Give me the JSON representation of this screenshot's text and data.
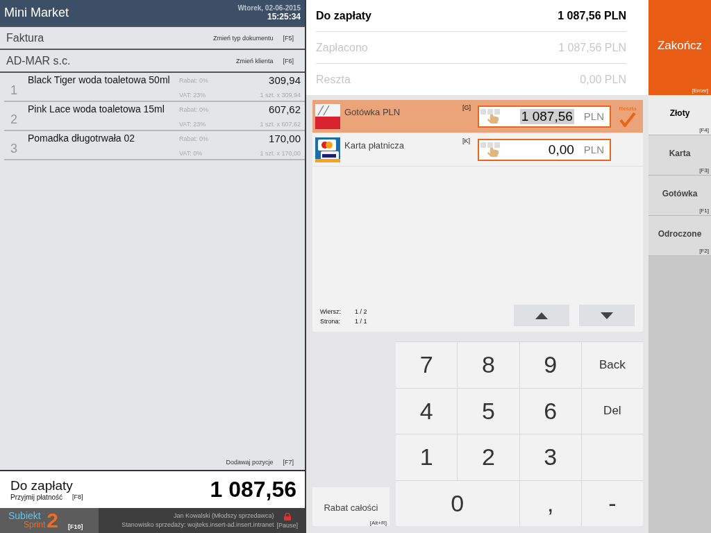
{
  "header": {
    "title": "Mini Market",
    "date": "Wtorek, 02-06-2015",
    "time": "15:25:34"
  },
  "document": {
    "type": "Faktura",
    "action": "Zmień typ dokumentu",
    "shortcut": "[F5]"
  },
  "client": {
    "name": "AD-MAR s.c.",
    "action": "Zmień klienta",
    "shortcut": "[F6]"
  },
  "items": [
    {
      "number": "1",
      "name": "Black Tiger woda toaletowa 50ml",
      "discount": "Rabat: 0%",
      "vat": "VAT: 23%",
      "total": "309,94",
      "quantity": "1 szt. x 309,94"
    },
    {
      "number": "2",
      "name": "Pink Lace woda toaletowa 15ml",
      "discount": "Rabat: 0%",
      "vat": "VAT: 23%",
      "total": "607,62",
      "quantity": "1 szt. x 607,62"
    },
    {
      "number": "3",
      "name": "Pomadka długotrwała 02",
      "discount": "Rabat: 0%",
      "vat": "VAT: 0%",
      "total": "170,00",
      "quantity": "1 szt. x 170,00"
    }
  ],
  "add_items": {
    "label": "Dodawaj pozycje",
    "shortcut": "[F7]"
  },
  "total": {
    "label": "Do zapłaty",
    "action": "Przyjmij płatność",
    "shortcut": "[F8]",
    "amount": "1 087,56"
  },
  "footer": {
    "logo_top": "Subiekt",
    "logo_bottom": "Sprint",
    "logo_number": "2",
    "logo_shortcut": "[F10]",
    "user": "Jan Kowalski (Młodszy sprzedawca)",
    "station": "Stanowisko sprzedaży: wojteks.insert-ad.insert.intranet",
    "pause": "[Pause]"
  },
  "summary": [
    {
      "label": "Do zapłaty",
      "value": "1 087,56 PLN",
      "emphasis": true
    },
    {
      "label": "Zapłacono",
      "value": "1 087,56 PLN",
      "emphasis": false
    },
    {
      "label": "Reszta",
      "value": "0,00 PLN",
      "emphasis": false
    }
  ],
  "finish": {
    "label": "Zakończ",
    "shortcut": "[Enter]"
  },
  "payments": [
    {
      "kind": "cash",
      "name": "Gotówka PLN",
      "shortcut": "[G]",
      "amount": "1 087,56",
      "currency": "PLN",
      "selected": true,
      "change_label": "Reszta",
      "checked": true
    },
    {
      "kind": "card",
      "name": "Karta płatnicza",
      "shortcut": "[K]",
      "amount": "0,00",
      "currency": "PLN",
      "selected": false,
      "checked": false
    }
  ],
  "pager": {
    "row_label": "Wiersz:",
    "row_value": "1 / 2",
    "page_label": "Strona:",
    "page_value": "1 / 1"
  },
  "payment_types": [
    {
      "label": "Złoty",
      "shortcut": "[F4]",
      "selected": true
    },
    {
      "label": "Karta",
      "shortcut": "[F3]",
      "selected": false
    },
    {
      "label": "Gotówka",
      "shortcut": "[F1]",
      "selected": false
    },
    {
      "label": "Odroczone",
      "shortcut": "[F2]",
      "selected": false
    }
  ],
  "keypad": [
    {
      "kind": "digit",
      "label": "7"
    },
    {
      "kind": "digit",
      "label": "8"
    },
    {
      "kind": "digit",
      "label": "9"
    },
    {
      "kind": "action",
      "label": "Back"
    },
    {
      "kind": "digit",
      "label": "4"
    },
    {
      "kind": "digit",
      "label": "5"
    },
    {
      "kind": "digit",
      "label": "6"
    },
    {
      "kind": "action",
      "label": "Del"
    },
    {
      "kind": "digit",
      "label": "1"
    },
    {
      "kind": "digit",
      "label": "2"
    },
    {
      "kind": "digit",
      "label": "3"
    },
    {
      "kind": "blank"
    },
    {
      "kind": "wide",
      "label": "0"
    },
    {
      "kind": "digit",
      "label": ","
    },
    {
      "kind": "digit",
      "label": "-"
    }
  ],
  "discount_button": {
    "label": "Rabat całości",
    "shortcut": "[Alt+R]"
  }
}
